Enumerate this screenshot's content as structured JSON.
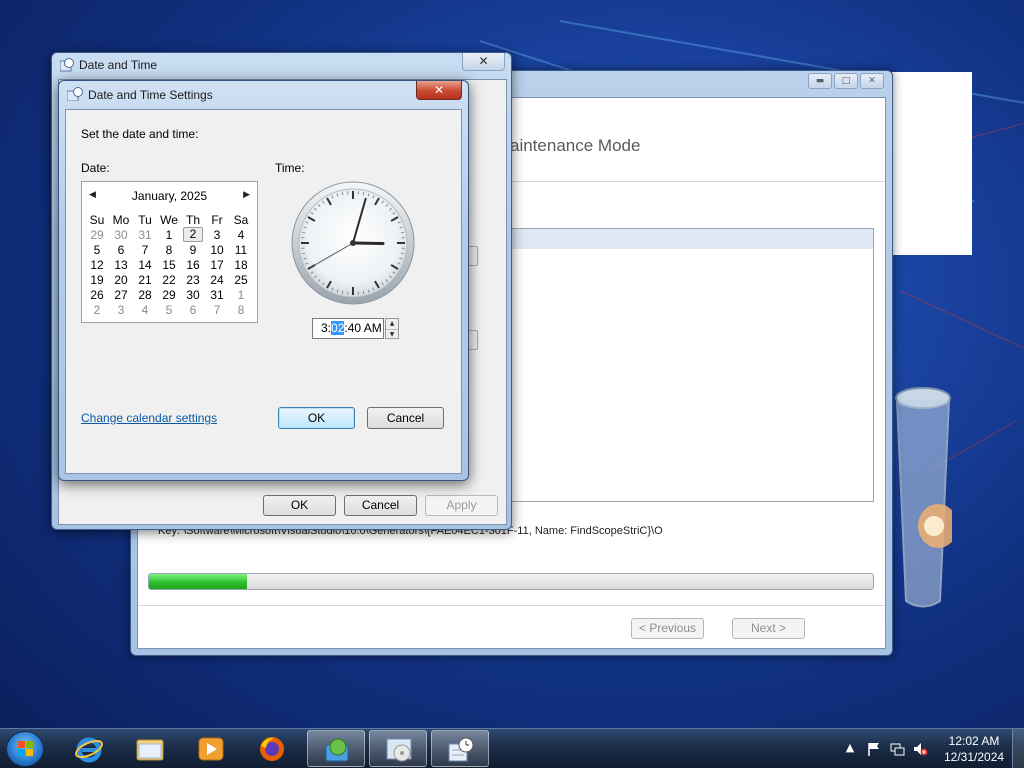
{
  "installer": {
    "heading": "aintenance Mode",
    "key_text": "Key: \\Software\\Microsoft\\VisualStudio\\10.0\\Generators\\{FAE04EC1-301F-11",
    "key_text_tail": ", Name: FindScopeStriC}\\O",
    "progress_value": 0.135,
    "previous_label": "< Previous",
    "next_label": "Next >"
  },
  "date_time_window": {
    "title": "Date and Time",
    "close_label": "✕",
    "ok_label": "OK",
    "cancel_label": "Cancel",
    "apply_label": "Apply"
  },
  "settings_dialog": {
    "title": "Date and Time Settings",
    "close_label": "✕",
    "instruction": "Set the date and time:",
    "date_label": "Date:",
    "time_label": "Time:",
    "calendar": {
      "month_year": "January, 2025",
      "weekdays": [
        "Su",
        "Mo",
        "Tu",
        "We",
        "Th",
        "Fr",
        "Sa"
      ],
      "weeks": [
        [
          "29",
          "30",
          "31",
          "1",
          "2",
          "3",
          "4"
        ],
        [
          "5",
          "6",
          "7",
          "8",
          "9",
          "10",
          "11"
        ],
        [
          "12",
          "13",
          "14",
          "15",
          "16",
          "17",
          "18"
        ],
        [
          "19",
          "20",
          "21",
          "22",
          "23",
          "24",
          "25"
        ],
        [
          "26",
          "27",
          "28",
          "29",
          "30",
          "31",
          "1"
        ],
        [
          "2",
          "3",
          "4",
          "5",
          "6",
          "7",
          "8"
        ]
      ],
      "selected_day": "2"
    },
    "time_prefix": "3:",
    "time_minutes": "02",
    "time_suffix": ":40 AM",
    "clock_hour": 3,
    "clock_minute": 2,
    "clock_second": 40,
    "change_calendar_link": "Change calendar settings",
    "ok_label": "OK",
    "cancel_label": "Cancel"
  },
  "taskbar": {
    "clock_time": "12:02 AM",
    "clock_date": "12/31/2024",
    "pinned": [
      "internet-explorer-icon",
      "windows-explorer-icon",
      "media-player-icon",
      "firefox-icon",
      "installer-icon",
      "setup-disc-icon",
      "date-time-icon"
    ]
  }
}
